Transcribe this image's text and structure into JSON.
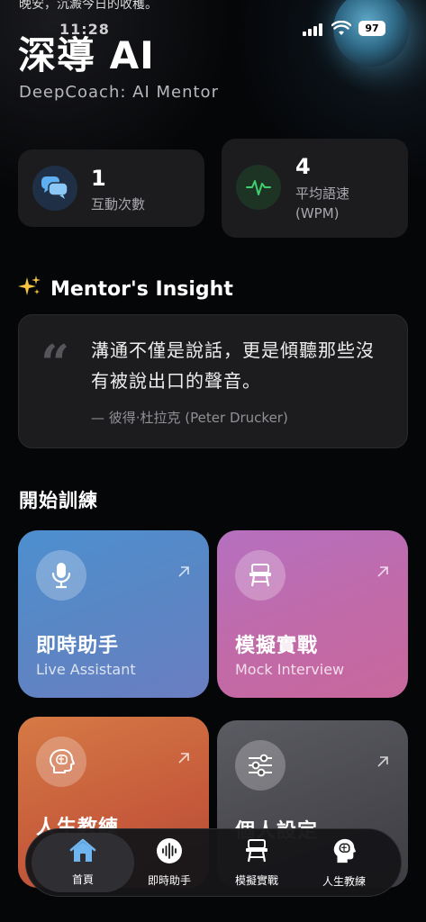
{
  "status_bar": {
    "time": "11:28",
    "battery": "97"
  },
  "greeting": "晚安，沉澱今日的收穫。",
  "app": {
    "title": "深導 AI",
    "subtitle": "DeepCoach: AI Mentor"
  },
  "stats": [
    {
      "value": "1",
      "label": "互動次數",
      "icon": "chat-bubbles-icon"
    },
    {
      "value": "4",
      "label": "平均語速\n(WPM)",
      "icon": "waveform-icon"
    }
  ],
  "insight": {
    "heading": "Mentor's Insight",
    "quote": "溝通不僅是說話，更是傾聽那些沒有被說出口的聲音。",
    "author": "— 彼得·杜拉克 (Peter Drucker)"
  },
  "training": {
    "section_title": "開始訓練",
    "tiles": [
      {
        "title": "即時助手",
        "subtitle": "Live Assistant",
        "icon": "microphone-icon"
      },
      {
        "title": "模擬實戰",
        "subtitle": "Mock Interview",
        "icon": "desk-icon"
      },
      {
        "title": "人生教練",
        "subtitle": "",
        "icon": "brain-head-icon"
      },
      {
        "title": "個人設定",
        "subtitle": "",
        "icon": "sliders-icon"
      }
    ]
  },
  "tab_bar": {
    "tabs": [
      {
        "label": "首頁",
        "icon": "home-icon",
        "active": true
      },
      {
        "label": "即時助手",
        "icon": "audio-wave-icon",
        "active": false
      },
      {
        "label": "模擬實戰",
        "icon": "desk-icon",
        "active": false
      },
      {
        "label": "人生教練",
        "icon": "brain-head-icon",
        "active": false
      }
    ]
  },
  "colors": {
    "background": "#050608",
    "card": "#1c1c1f",
    "tile_live": "#5a86c4",
    "tile_mock": "#c16aa8",
    "tile_coach": "#c65a3b",
    "tile_settings": "#48484e",
    "home_icon": "#6fb5ef",
    "wave_green": "#3ecf6e",
    "chat_blue": "#5fb0f2"
  }
}
